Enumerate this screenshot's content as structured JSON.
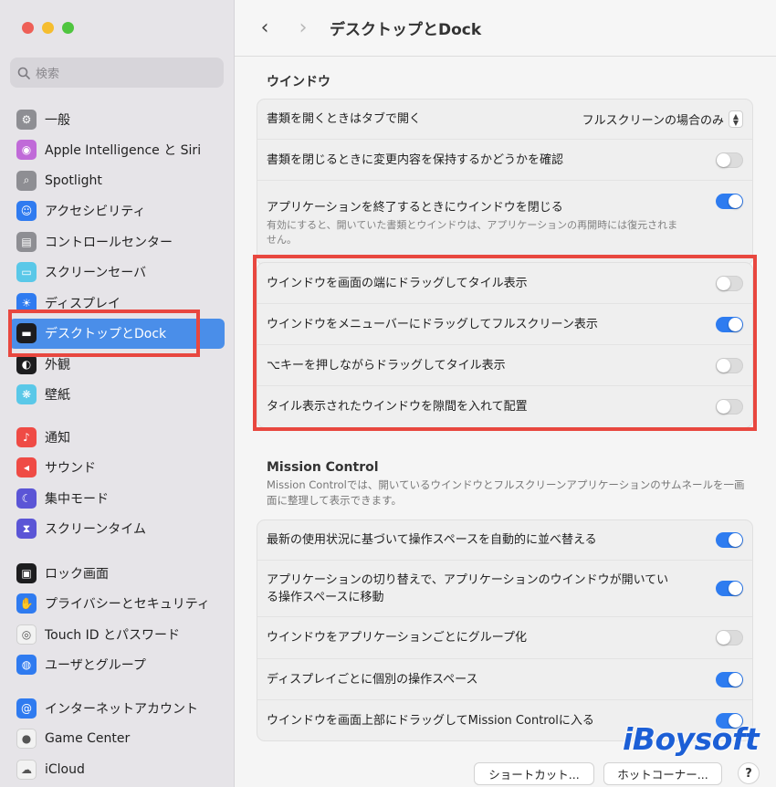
{
  "window": {
    "title": "デスクトップとDock",
    "traffic_colors": [
      "#ee5f57",
      "#f5bd2f",
      "#4fc53f"
    ]
  },
  "search": {
    "placeholder": "検索"
  },
  "sidebar": {
    "group1": [
      {
        "label": "一般",
        "icon": "gear-icon",
        "color": "#8e8e93",
        "glyph": "⚙"
      },
      {
        "label": "Apple Intelligence と Siri",
        "icon": "siri-icon",
        "color": "#c06ad8",
        "glyph": "◉"
      },
      {
        "label": "Spotlight",
        "icon": "magnifier-icon",
        "color": "#8e8e93",
        "glyph": "⌕"
      },
      {
        "label": "アクセシビリティ",
        "icon": "accessibility-icon",
        "color": "#2f7bf0",
        "glyph": "☺"
      },
      {
        "label": "コントロールセンター",
        "icon": "control-center-icon",
        "color": "#8e8e93",
        "glyph": "▤"
      },
      {
        "label": "スクリーンセーバ",
        "icon": "screensaver-icon",
        "color": "#5ac8e8",
        "glyph": "▭"
      },
      {
        "label": "ディスプレイ",
        "icon": "sun-icon",
        "color": "#2f7bf0",
        "glyph": "☀"
      },
      {
        "label": "デスクトップとDock",
        "icon": "dock-icon",
        "color": "#1d1d1f",
        "glyph": "▬"
      },
      {
        "label": "外観",
        "icon": "appearance-icon",
        "color": "#1d1d1f",
        "glyph": "◐"
      },
      {
        "label": "壁紙",
        "icon": "wallpaper-icon",
        "color": "#5ac8e8",
        "glyph": "❋"
      }
    ],
    "group2": [
      {
        "label": "通知",
        "icon": "bell-icon",
        "color": "#ef4b45",
        "glyph": "♪"
      },
      {
        "label": "サウンド",
        "icon": "speaker-icon",
        "color": "#ef4b45",
        "glyph": "◂"
      },
      {
        "label": "集中モード",
        "icon": "moon-icon",
        "color": "#5b55d6",
        "glyph": "☾"
      },
      {
        "label": "スクリーンタイム",
        "icon": "hourglass-icon",
        "color": "#5b55d6",
        "glyph": "⧗"
      }
    ],
    "group3": [
      {
        "label": "ロック画面",
        "icon": "lock-icon",
        "color": "#1d1d1f",
        "glyph": "▣"
      },
      {
        "label": "プライバシーとセキュリティ",
        "icon": "hand-icon",
        "color": "#2f7bf0",
        "glyph": "✋"
      },
      {
        "label": "Touch ID とパスワード",
        "icon": "fingerprint-icon",
        "color": "#f2f2f2",
        "glyph": "◎"
      },
      {
        "label": "ユーザとグループ",
        "icon": "users-icon",
        "color": "#2f7bf0",
        "glyph": "◍"
      }
    ],
    "group4": [
      {
        "label": "インターネットアカウント",
        "icon": "at-icon",
        "color": "#2f7bf0",
        "glyph": "@"
      },
      {
        "label": "Game Center",
        "icon": "game-center-icon",
        "color": "#f2f2f2",
        "glyph": "●"
      },
      {
        "label": "iCloud",
        "icon": "cloud-icon",
        "color": "#f2f2f2",
        "glyph": "☁"
      }
    ]
  },
  "windows_section": {
    "heading": "ウインドウ",
    "open_docs_label": "書類を開くときはタブで開く",
    "open_docs_value": "フルスクリーンの場合のみ",
    "rows": [
      {
        "label": "書類を閉じるときに変更内容を保持するかどうかを確認",
        "on": false
      },
      {
        "label": "アプリケーションを終了するときにウインドウを閉じる",
        "on": true,
        "sub": "有効にすると、開いていた書類とウインドウは、アプリケーションの再開時には復元されません。"
      }
    ],
    "tile_rows": [
      {
        "label": "ウインドウを画面の端にドラッグしてタイル表示",
        "on": false
      },
      {
        "label": "ウインドウをメニューバーにドラッグしてフルスクリーン表示",
        "on": true
      },
      {
        "label": "⌥キーを押しながらドラッグしてタイル表示",
        "on": false
      },
      {
        "label": "タイル表示されたウインドウを隙間を入れて配置",
        "on": false
      }
    ]
  },
  "mission_control": {
    "heading": "Mission Control",
    "description": "Mission Controlでは、開いているウインドウとフルスクリーンアプリケーションのサムネールを一画面に整理して表示できます。",
    "rows": [
      {
        "label": "最新の使用状況に基づいて操作スペースを自動的に並べ替える",
        "on": true
      },
      {
        "label": "アプリケーションの切り替えで、アプリケーションのウインドウが開いている操作スペースに移動",
        "on": true
      },
      {
        "label": "ウインドウをアプリケーションごとにグループ化",
        "on": false
      },
      {
        "label": "ディスプレイごとに個別の操作スペース",
        "on": true
      },
      {
        "label": "ウインドウを画面上部にドラッグしてMission Controlに入る",
        "on": true
      }
    ]
  },
  "footer": {
    "shortcuts_label": "ショートカット...",
    "hot_corners_label": "ホットコーナー...",
    "help_label": "?"
  },
  "watermark": "iBoysoft",
  "accent_color": "#2e7cf0",
  "annotation_color": "#e8473f"
}
